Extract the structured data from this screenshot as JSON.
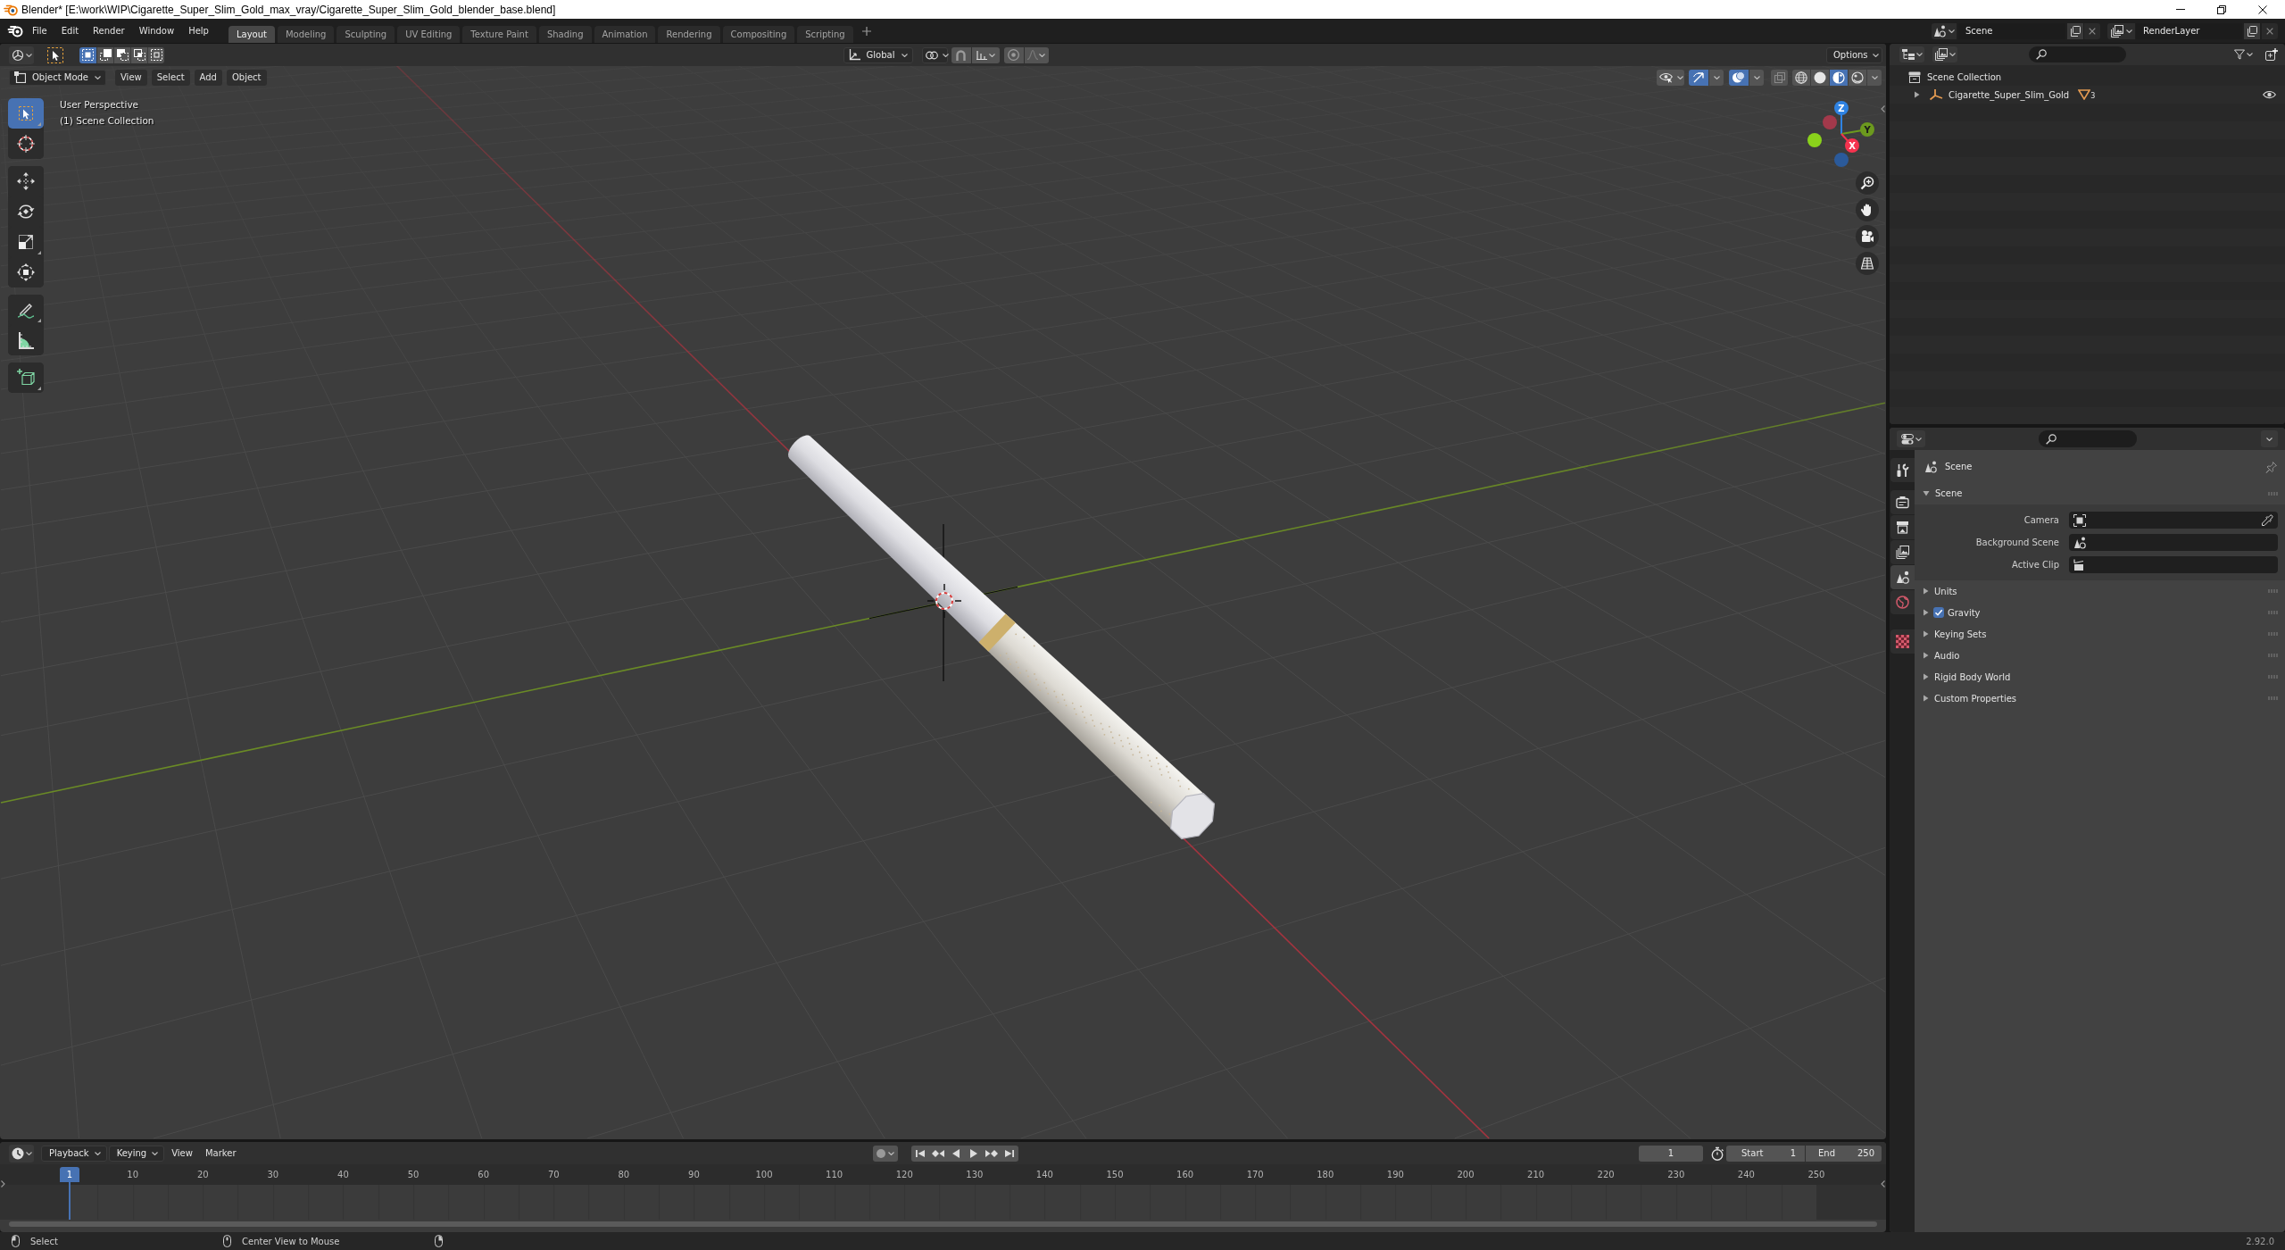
{
  "window": {
    "title": "Blender* [E:\\work\\WIP\\Cigarette_Super_Slim_Gold_max_vray/Cigarette_Super_Slim_Gold_blender_base.blend]"
  },
  "menu_bar": {
    "menus": [
      "File",
      "Edit",
      "Render",
      "Window",
      "Help"
    ],
    "workspaces": [
      {
        "label": "Layout",
        "selected": true
      },
      {
        "label": "Modeling",
        "selected": false
      },
      {
        "label": "Sculpting",
        "selected": false
      },
      {
        "label": "UV Editing",
        "selected": false
      },
      {
        "label": "Texture Paint",
        "selected": false
      },
      {
        "label": "Shading",
        "selected": false
      },
      {
        "label": "Animation",
        "selected": false
      },
      {
        "label": "Rendering",
        "selected": false
      },
      {
        "label": "Compositing",
        "selected": false
      },
      {
        "label": "Scripting",
        "selected": false
      }
    ],
    "scene": "Scene",
    "view_layer": "RenderLayer"
  },
  "viewport": {
    "tool_settings": {
      "select_modes": [
        {
          "kind": "set",
          "selected": true
        },
        {
          "kind": "extend",
          "selected": false
        },
        {
          "kind": "subtract",
          "selected": false
        },
        {
          "kind": "difference",
          "selected": false
        },
        {
          "kind": "intersect",
          "selected": false
        }
      ],
      "orientation": "Global",
      "proportional_editing": {
        "on": false
      },
      "options": "Options"
    },
    "header": {
      "mode": "Object Mode",
      "menus": [
        "View",
        "Select",
        "Add",
        "Object"
      ],
      "gizmos": {
        "on": true
      },
      "overlays": {
        "on": true
      },
      "xray": {
        "on": false
      },
      "shading": [
        {
          "kind": "wireframe",
          "selected": false
        },
        {
          "kind": "solid",
          "selected": false
        },
        {
          "kind": "material",
          "selected": true
        },
        {
          "kind": "rendered",
          "selected": false
        }
      ]
    },
    "view_name": "User Perspective",
    "collection_label": "(1) Scene Collection",
    "tool_groups": [
      {
        "tools": [
          {
            "kind": "select_box",
            "selected": true,
            "more": true
          },
          {
            "kind": "cursor",
            "selected": false,
            "more": false
          }
        ]
      },
      {
        "tools": [
          {
            "kind": "move",
            "selected": false,
            "more": false
          },
          {
            "kind": "rotate",
            "selected": false,
            "more": false
          },
          {
            "kind": "scale",
            "selected": false,
            "more": true
          },
          {
            "kind": "transform",
            "selected": false,
            "more": false
          }
        ]
      },
      {
        "tools": [
          {
            "kind": "annotate",
            "selected": false,
            "more": true
          },
          {
            "kind": "measure",
            "selected": false,
            "more": false
          }
        ]
      },
      {
        "tools": [
          {
            "kind": "add_cube",
            "selected": false,
            "more": true
          }
        ]
      }
    ],
    "gizmo_axes": [
      {
        "label": "Z",
        "color": "#2f83e3"
      },
      {
        "label": "Y",
        "color": "#6c9a1e"
      },
      {
        "label": "X",
        "color": "#f5334f"
      }
    ]
  },
  "outliner": {
    "root": "Scene Collection",
    "items": [
      {
        "name": "Cigarette_Super_Slim_Gold",
        "expanded": false,
        "child_count": "3",
        "visible": true
      }
    ]
  },
  "properties": {
    "tab_groups": [
      {
        "tabs": [
          {
            "kind": "tool",
            "selected": false
          }
        ]
      },
      {
        "tabs": [
          {
            "kind": "render",
            "selected": false
          },
          {
            "kind": "output",
            "selected": false
          },
          {
            "kind": "view_layer",
            "selected": false
          }
        ]
      },
      {
        "tabs": [
          {
            "kind": "scene",
            "selected": true
          },
          {
            "kind": "world",
            "selected": false
          }
        ]
      },
      {
        "tabs": [
          {
            "kind": "texture",
            "selected": false
          }
        ]
      }
    ],
    "context": "Scene",
    "panels": [
      {
        "kind": "plain",
        "title": "Scene",
        "expanded": true,
        "fields": [
          {
            "kind": "camera",
            "label": "Camera"
          },
          {
            "kind": "scene",
            "label": "Background Scene"
          },
          {
            "kind": "clip",
            "label": "Active Clip"
          }
        ]
      },
      {
        "kind": "plain",
        "title": "Units",
        "expanded": false
      },
      {
        "kind": "toggle",
        "title": "Gravity",
        "expanded": false,
        "checked": true
      },
      {
        "kind": "plain",
        "title": "Keying Sets",
        "expanded": false
      },
      {
        "kind": "plain",
        "title": "Audio",
        "expanded": false
      },
      {
        "kind": "plain",
        "title": "Rigid Body World",
        "expanded": false
      },
      {
        "kind": "plain",
        "title": "Custom Properties",
        "expanded": false
      }
    ]
  },
  "timeline": {
    "menus": [
      {
        "label": "Playback",
        "dropdown": true
      },
      {
        "label": "Keying",
        "dropdown": true
      },
      {
        "label": "View",
        "dropdown": false
      },
      {
        "label": "Marker",
        "dropdown": false
      }
    ],
    "auto_keying": {
      "on": false
    },
    "current_frame": "1",
    "start": {
      "label": "Start",
      "value": "1"
    },
    "end": {
      "label": "End",
      "value": "250"
    },
    "playhead": "1",
    "frame_labels": [
      "10",
      "20",
      "30",
      "40",
      "50",
      "60",
      "70",
      "80",
      "90",
      "100",
      "110",
      "120",
      "130",
      "140",
      "150",
      "160",
      "170",
      "180",
      "190",
      "200",
      "210",
      "220",
      "230",
      "240",
      "250"
    ]
  },
  "status_bar": {
    "hints": [
      {
        "kind": "left_click",
        "label": "Select"
      },
      {
        "kind": "middle_click",
        "label": "Center View to Mouse"
      },
      {
        "kind": "right_click"
      }
    ],
    "version": "2.92.0"
  }
}
